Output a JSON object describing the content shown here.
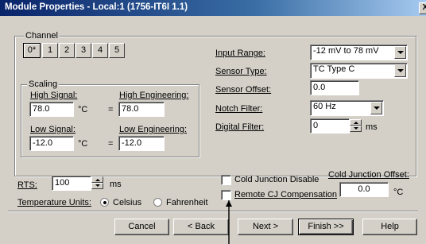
{
  "window": {
    "title": "Module Properties - Local:1 (1756-IT6I 1.1)",
    "close": "X"
  },
  "channel": {
    "legend": "Channel",
    "tabs": [
      "0*",
      "1",
      "2",
      "3",
      "4",
      "5"
    ]
  },
  "scaling": {
    "legend": "Scaling",
    "high_signal_label": "High Signal:",
    "high_signal_value": "78.0",
    "high_unit": "°C",
    "equals": "=",
    "high_eng_label": "High Engineering:",
    "high_eng_value": "78.0",
    "low_signal_label": "Low Signal:",
    "low_signal_value": "-12.0",
    "low_unit": "°C",
    "low_eng_label": "Low Engineering:",
    "low_eng_value": "-12.0"
  },
  "config": {
    "input_range_label": "Input Range:",
    "input_range_value": "-12 mV to 78 mV",
    "sensor_type_label": "Sensor Type:",
    "sensor_type_value": "TC Type C",
    "sensor_offset_label": "Sensor Offset:",
    "sensor_offset_value": "0.0",
    "notch_filter_label": "Notch Filter:",
    "notch_filter_value": "60 Hz",
    "digital_filter_label": "Digital Filter:",
    "digital_filter_value": "0",
    "digital_filter_unit": "ms"
  },
  "rts": {
    "label": "RTS:",
    "value": "100",
    "unit": "ms"
  },
  "temperature_units": {
    "label": "Temperature Units:",
    "celsius": "Celsius",
    "fahrenheit": "Fahrenheit",
    "selected": "Celsius"
  },
  "cold_junction": {
    "disable_label": "Cold Junction Disable",
    "remote_label": "Remote CJ Compensation",
    "offset_label": "Cold Junction Offset:",
    "offset_value": "0.0",
    "offset_unit": "°C"
  },
  "buttons": {
    "cancel": "Cancel",
    "back": "< Back",
    "next": "Next >",
    "finish": "Finish >>",
    "help": "Help"
  }
}
